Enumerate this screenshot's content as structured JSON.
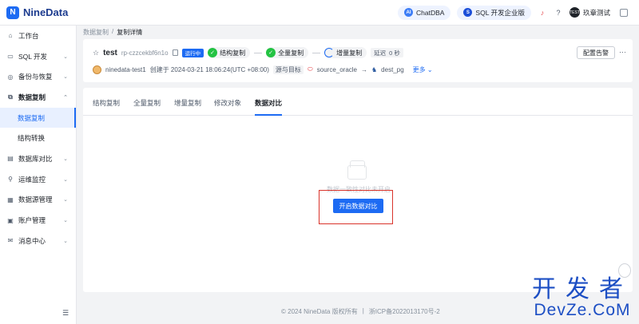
{
  "app": {
    "name": "NineData",
    "logo_mark": "N"
  },
  "topbar": {
    "chatdba": {
      "label": "ChatDBA",
      "icon": "chatdba-icon"
    },
    "sql_edition": {
      "label": "SQL 开发企业版",
      "icon": "sql-icon"
    },
    "user": {
      "avatar_text": "TEST",
      "name": "玖章测试"
    }
  },
  "sidebar": {
    "items": [
      {
        "label": "工作台",
        "icon": "home-icon",
        "chevron": ""
      },
      {
        "label": "SQL 开发",
        "icon": "code-icon",
        "chevron": "⌄"
      },
      {
        "label": "备份与恢复",
        "icon": "backup-icon",
        "chevron": "⌄"
      },
      {
        "label": "数据复制",
        "icon": "replication-icon",
        "chevron": "⌃"
      },
      {
        "label": "数据复制"
      },
      {
        "label": "结构转换"
      },
      {
        "label": "数据库对比",
        "icon": "compare-icon",
        "chevron": "⌄"
      },
      {
        "label": "运维监控",
        "icon": "monitor-icon",
        "chevron": "⌄"
      },
      {
        "label": "数据源管理",
        "icon": "datasource-icon",
        "chevron": "⌄"
      },
      {
        "label": "账户管理",
        "icon": "account-icon",
        "chevron": "⌄"
      },
      {
        "label": "消息中心",
        "icon": "message-icon",
        "chevron": "⌄"
      }
    ]
  },
  "breadcrumb": {
    "parent": "数据复制",
    "sep": "/",
    "current": "复制详情"
  },
  "task": {
    "name": "test",
    "id": "rp-czzcekbf6n1o",
    "status": "运行中",
    "steps": [
      "结构复制",
      "全量复制",
      "增量复制"
    ],
    "delay_label": "延迟",
    "delay_value": "0 秒",
    "config_alert_label": "配置告警",
    "more": "···"
  },
  "meta": {
    "creator": "ninedata-test1",
    "created_text": "创建于 2024-03-21 18:06:24(UTC +08:00)",
    "src_target_label": "源与目标",
    "source": "source_oracle",
    "arrow": "→",
    "target": "dest_pg",
    "more_label": "更多"
  },
  "tabs": [
    "结构复制",
    "全量复制",
    "增量复制",
    "修改对象",
    "数据对比"
  ],
  "empty": {
    "text": "数据一致性对比未开启",
    "button_label": "开启数据对比"
  },
  "footer": {
    "copyright": "© 2024 NineData 版权所有",
    "sep": "|",
    "icp": "浙ICP备2022013170号-2"
  },
  "watermark": {
    "top": "开发者",
    "bottom": "DevZe.CoM"
  },
  "colors": {
    "primary": "#1d6bf3",
    "success": "#23c343",
    "highlight": "#d9342b"
  }
}
